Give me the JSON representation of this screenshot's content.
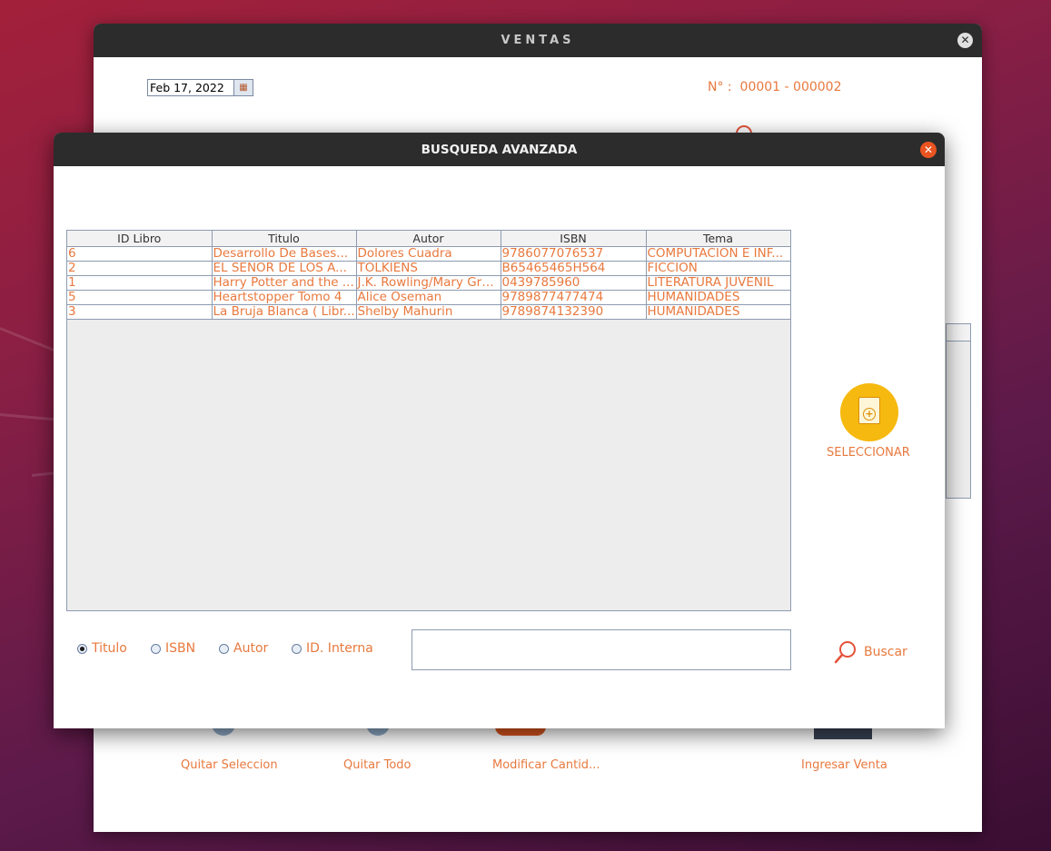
{
  "ventas_window": {
    "title": "VENTAS",
    "close_glyph": "✕",
    "date": "Feb 17, 2022",
    "number_label": "N° :",
    "number_value": "00001 - 000002",
    "actions": [
      {
        "label": "Quitar Seleccion",
        "icon": "remove-selection-icon"
      },
      {
        "label": "Quitar Todo",
        "icon": "remove-all-icon"
      },
      {
        "label": "Modificar Cantid...",
        "icon": "edit-quantity-icon"
      },
      {
        "label": "Ingresar Venta",
        "icon": "register-sale-icon"
      }
    ]
  },
  "dialog": {
    "title": "BUSQUEDA AVANZADA",
    "close_glyph": "✕",
    "table": {
      "columns": [
        "ID Libro",
        "Titulo",
        "Autor",
        "ISBN",
        "Tema"
      ],
      "rows": [
        [
          "6",
          "Desarrollo De Bases...",
          "Dolores Cuadra",
          "9786077076537",
          "COMPUTACION E INF..."
        ],
        [
          "2",
          "EL SEÑOR DE LOS A...",
          "TOLKIENS",
          "B65465465H564",
          "FICCION"
        ],
        [
          "1",
          "Harry Potter and the ...",
          "J.K. Rowling/Mary Gra...",
          "0439785960",
          "LITERATURA JUVENIL"
        ],
        [
          "5",
          "Heartstopper Tomo 4",
          "Alice Oseman",
          "9789877477474",
          "HUMANIDADES"
        ],
        [
          "3",
          "La Bruja Blanca ( Libr...",
          "Shelby Mahurin",
          "9789874132390",
          "HUMANIDADES"
        ]
      ]
    },
    "select_button_label": "SELECCIONAR",
    "search_options": [
      {
        "label": "Titulo",
        "checked": true
      },
      {
        "label": "ISBN",
        "checked": false
      },
      {
        "label": "Autor",
        "checked": false
      },
      {
        "label": "ID. Interna",
        "checked": false
      }
    ],
    "search_value": "",
    "search_button_label": "Buscar"
  },
  "colors": {
    "accent": "#e8793e",
    "close_button": "#e95420",
    "select_button": "#f6b90f"
  }
}
